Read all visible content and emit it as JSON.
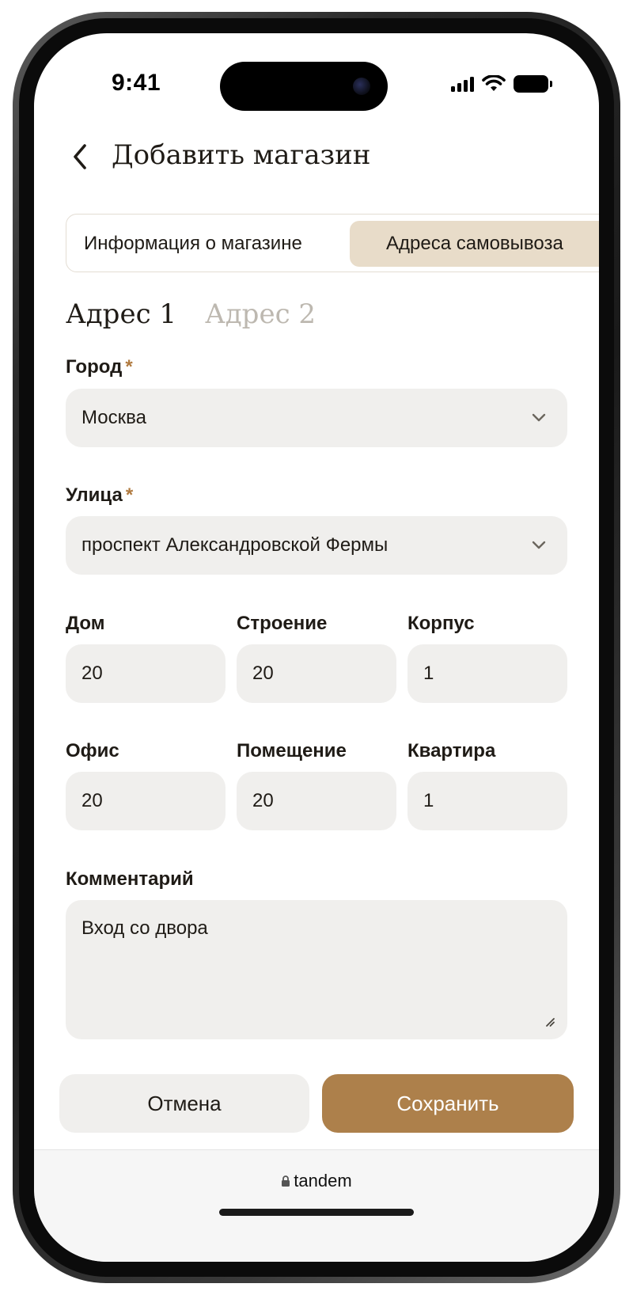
{
  "status_bar": {
    "time": "9:41"
  },
  "header": {
    "title": "Добавить магазин",
    "back_icon": "chevron-left-icon"
  },
  "tabs": [
    {
      "label": "Информация о магазине",
      "active": false
    },
    {
      "label": "Адреса самовывоза",
      "active": true
    }
  ],
  "address_tabs": [
    {
      "label": "Адрес 1",
      "active": true
    },
    {
      "label": "Адрес 2",
      "active": false
    }
  ],
  "form": {
    "required_mark": "*",
    "city": {
      "label": "Город",
      "value": "Москва"
    },
    "street": {
      "label": "Улица",
      "value": "проспект Александровской Фермы"
    },
    "house": {
      "label": "Дом",
      "value": "20"
    },
    "building": {
      "label": "Строение",
      "value": "20"
    },
    "block": {
      "label": "Корпус",
      "value": "1"
    },
    "office": {
      "label": "Офис",
      "value": "20"
    },
    "premises": {
      "label": "Помещение",
      "value": "20"
    },
    "apartment": {
      "label": "Квартира",
      "value": "1"
    },
    "comment": {
      "label": "Комментарий",
      "value": "Вход со двора"
    }
  },
  "actions": {
    "cancel_label": "Отмена",
    "save_label": "Сохранить"
  },
  "browser": {
    "url": "tandem"
  },
  "colors": {
    "accent": "#ad804b",
    "active_tab_bg": "#e8dcc9",
    "field_bg": "#f0efed",
    "required": "#b07a3f",
    "inactive_text": "#bdb8b0"
  }
}
